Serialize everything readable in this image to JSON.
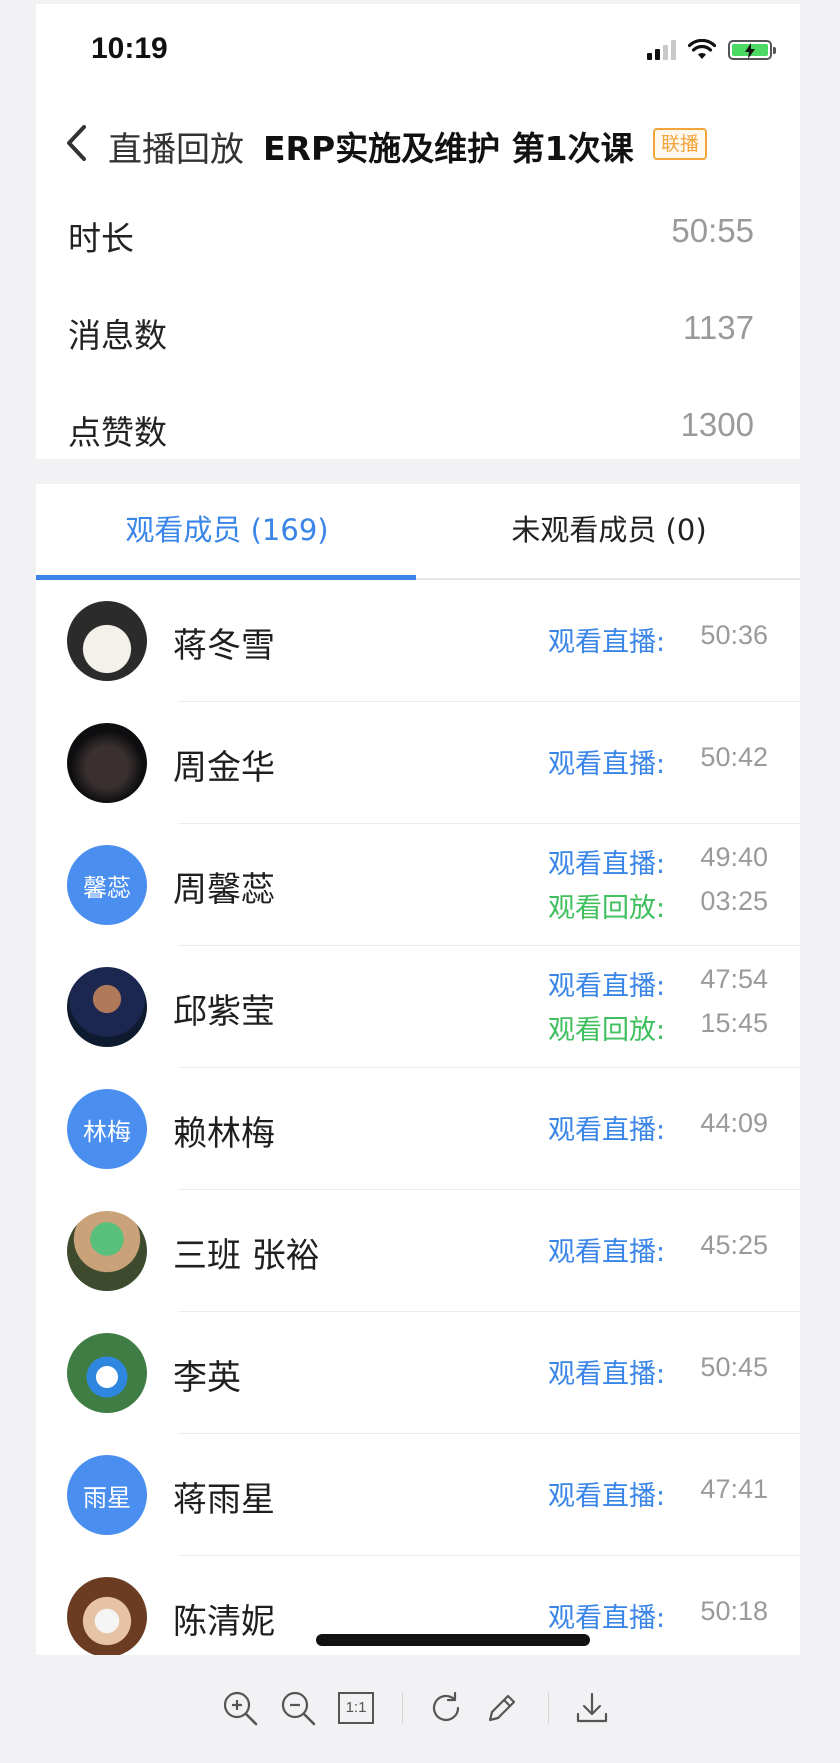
{
  "status_bar": {
    "time": "10:19"
  },
  "nav": {
    "back_label": "直播回放",
    "title": "ERP实施及维护 第1次课",
    "badge": "联播"
  },
  "stats": [
    {
      "label": "时长",
      "value": "50:55"
    },
    {
      "label": "消息数",
      "value": "1137"
    },
    {
      "label": "点赞数",
      "value": "1300"
    }
  ],
  "tabs": {
    "watched": "观看成员 (169)",
    "unwatched": "未观看成员 (0)"
  },
  "labels": {
    "live": "观看直播:",
    "replay": "观看回放:"
  },
  "members": [
    {
      "name": "蒋冬雪",
      "avatar": "cat-photo",
      "live": "50:36"
    },
    {
      "name": "周金华",
      "avatar": "dark-photo",
      "live": "50:42"
    },
    {
      "name": "周馨蕊",
      "avatar_text": "馨蕊",
      "live": "49:40",
      "replay": "03:25"
    },
    {
      "name": "邱紫莹",
      "avatar": "man-photo",
      "live": "47:54",
      "replay": "15:45"
    },
    {
      "name": "赖林梅",
      "avatar_text": "林梅",
      "live": "44:09"
    },
    {
      "name": "三班 张裕",
      "avatar": "anime-photo",
      "live": "45:25"
    },
    {
      "name": "李英",
      "avatar": "cartoon-photo",
      "live": "50:45"
    },
    {
      "name": "蒋雨星",
      "avatar_text": "雨星",
      "live": "47:41"
    },
    {
      "name": "陈清妮",
      "avatar": "mask-photo",
      "live": "50:18"
    }
  ],
  "toolbar_icons": [
    "zoom-in-icon",
    "zoom-out-icon",
    "actual-size-icon",
    "rotate-icon",
    "edit-icon",
    "download-icon"
  ],
  "toolbar": {
    "actual_size": "1:1"
  },
  "colors": {
    "accent_blue": "#3a86e8",
    "replay_green": "#3fbf5e",
    "badge_orange": "#f3a53b",
    "avatar_blue": "#4a8ff0"
  }
}
